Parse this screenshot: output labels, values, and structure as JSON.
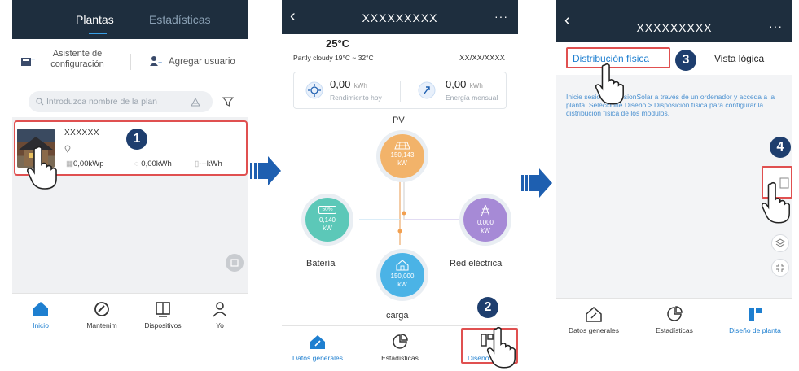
{
  "phone1": {
    "tabs": [
      "Plantas",
      "Estadísticas"
    ],
    "wizard_label_line1": "Asistente de",
    "wizard_label_line2": "configuración",
    "add_user_label": "Agregar usuario",
    "search_placeholder": "Introduzca nombre de la plan",
    "plant": {
      "name": "XXXXXX",
      "capacity": "0,00kWp",
      "energy": "0,00kWh",
      "yield": "--kWh"
    },
    "step_badge": "1",
    "nav": [
      {
        "label": "Inicio",
        "icon": "home-icon"
      },
      {
        "label": "Mantenim",
        "icon": "maintenance-icon"
      },
      {
        "label": "Dispositivos",
        "icon": "devices-icon"
      },
      {
        "label": "Yo",
        "icon": "user-icon"
      }
    ]
  },
  "phone2": {
    "title": "XXXXXXXXX",
    "temperature": "25°C",
    "weather": "Partly cloudy 19°C ~ 32°C",
    "date": "XX/XX/XXXX",
    "today_value": "0,00",
    "today_unit": "kWh",
    "today_label": "Rendimiento hoy",
    "month_value": "0,00",
    "month_unit": "kWh",
    "month_label": "Energía mensual",
    "pv_label": "PV",
    "pv_value": "150,143",
    "pv_unit": "kW",
    "battery_label": "Batería",
    "battery_percent": "50%",
    "battery_value": "0,140",
    "battery_unit": "kW",
    "grid_label": "Red eléctrica",
    "grid_value": "0,000",
    "grid_unit": "kW",
    "load_label": "carga",
    "load_value": "150,000",
    "load_unit": "kW",
    "step_badge": "2",
    "nav": [
      {
        "label": "Datos generales",
        "icon": "overview-icon"
      },
      {
        "label": "Estadísticas",
        "icon": "statistics-icon"
      },
      {
        "label": "Diseño",
        "icon": "layout-icon"
      }
    ]
  },
  "phone3": {
    "title": "XXXXXXXXX",
    "tab_physical": "Distribución física",
    "tab_logical": "Vista lógica",
    "info_text": "Inicie sesión en FusionSolar a través de un ordenador y acceda a la planta. Seleccione Diseño > Disposición física para configurar la distribución física de los módulos.",
    "step_badge_3": "3",
    "step_badge_4": "4",
    "nav": [
      {
        "label": "Datos generales",
        "icon": "overview-icon"
      },
      {
        "label": "Estadísticas",
        "icon": "statistics-icon"
      },
      {
        "label": "Diseño de planta",
        "icon": "plant-layout-icon"
      }
    ]
  },
  "colors": {
    "header": "#1e2e3e",
    "accent": "#1e7fd0",
    "highlight": "#e05050",
    "badge": "#1e3e6e",
    "pv": "#f2b36a",
    "battery": "#5cc8b8",
    "grid": "#a68ad6",
    "load": "#4bb3e6"
  }
}
